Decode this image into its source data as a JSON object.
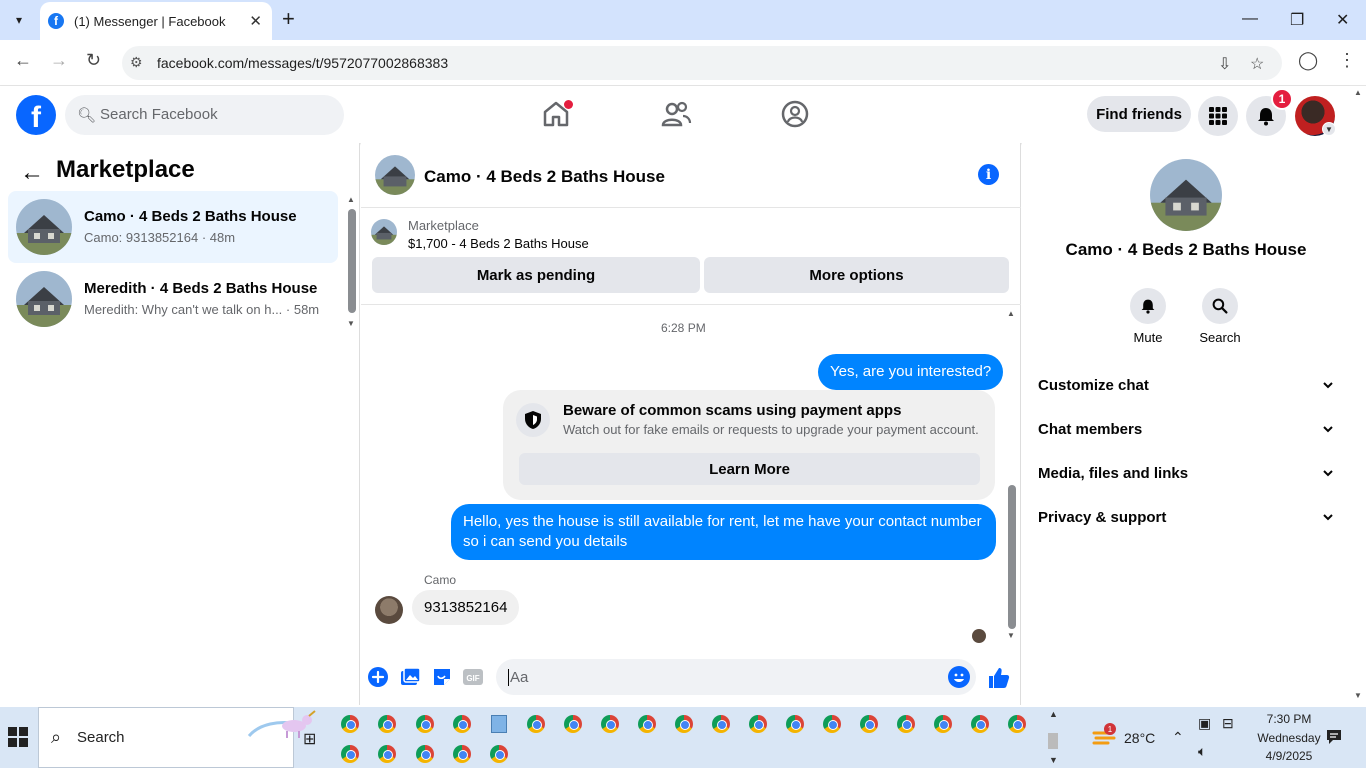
{
  "browser": {
    "tab_title": "(1) Messenger | Facebook",
    "url": "facebook.com/messages/t/9572077002868383"
  },
  "header": {
    "search_placeholder": "Search Facebook",
    "find_friends": "Find friends",
    "notification_count": "1"
  },
  "sidebar": {
    "title": "Marketplace",
    "conversations": [
      {
        "name": "Camo · 4 Beds 2 Baths House",
        "snippet": "Camo: 9313852164 · 48m"
      },
      {
        "name": "Meredith · 4 Beds 2 Baths House",
        "snippet": "Meredith: Why can't we talk on h... · 58m"
      }
    ]
  },
  "chat": {
    "title": "Camo · 4 Beds 2 Baths House",
    "marketplace_label": "Marketplace",
    "listing": "$1,700 - 4 Beds 2 Baths House",
    "mark_pending": "Mark as pending",
    "more_options": "More options",
    "timestamp": "6:28 PM",
    "messages": [
      {
        "from": "me",
        "text": "Yes, are you interested?"
      },
      {
        "from": "me",
        "text": "Hello, yes the house is still available for rent, let me have your contact number so i can send you  details"
      },
      {
        "from": "Camo",
        "text": "9313852164"
      }
    ],
    "scam_notice": {
      "title": "Beware of common scams using payment apps",
      "subtitle": "Watch out for fake emails or requests to upgrade your payment account.",
      "button": "Learn More"
    },
    "sender_name": "Camo",
    "composer_placeholder": "Aa"
  },
  "details": {
    "name": "Camo · 4 Beds 2 Baths House",
    "actions": [
      {
        "label": "Mute",
        "icon": "bell-icon"
      },
      {
        "label": "Search",
        "icon": "search-icon"
      }
    ],
    "sections": [
      "Customize chat",
      "Chat members",
      "Media, files and links",
      "Privacy & support"
    ]
  },
  "taskbar": {
    "search_label": "Search",
    "temperature": "28°C",
    "weather_badge": "1",
    "time": "7:30 PM",
    "day": "Wednesday",
    "date": "4/9/2025"
  },
  "colors": {
    "accent": "#0084ff",
    "fb_blue": "#0866ff",
    "badge_red": "#e41e3f",
    "tab_strip": "#d3e3fd"
  }
}
